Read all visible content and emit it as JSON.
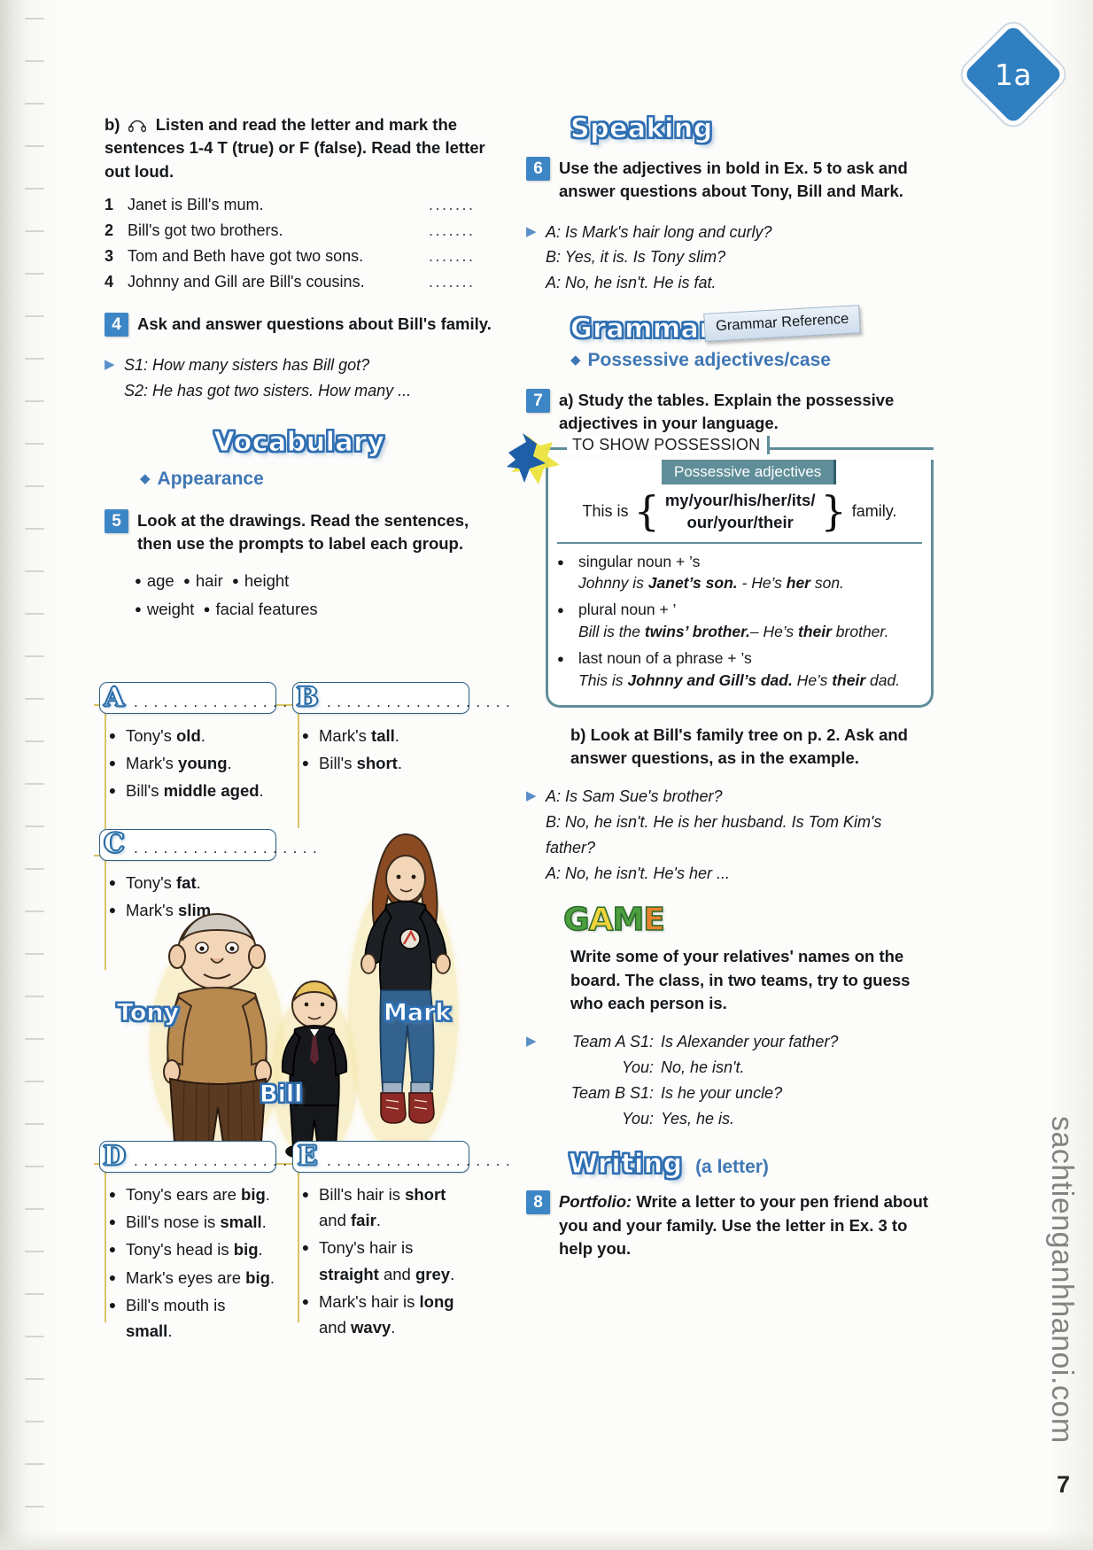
{
  "unit_badge": "1a",
  "page_number": "7",
  "watermark": "sachtienganhhanoi.com",
  "left": {
    "ex3b": {
      "lead": "b)",
      "headphone_icon": "headphones-icon",
      "instruction": "Listen and read the letter and mark the sentences 1-4 T (true) or F (false). Read the letter out loud.",
      "sentences": [
        {
          "n": "1",
          "text": "Janet is Bill's mum.",
          "dots": "......."
        },
        {
          "n": "2",
          "text": "Bill's got two brothers.",
          "dots": "......."
        },
        {
          "n": "3",
          "text": "Tom and Beth have got two sons.",
          "dots": "......."
        },
        {
          "n": "4",
          "text": "Johnny and Gill are Bill's cousins.",
          "dots": "......."
        }
      ]
    },
    "ex4": {
      "number": "4",
      "instruction": "Ask and answer questions about Bill's family.",
      "dialogue": [
        "S1: How many sisters has Bill got?",
        "S2: He has got two sisters. How many ..."
      ]
    },
    "vocabulary_heading": "Vocabulary",
    "vocabulary_sub": "Appearance",
    "ex5": {
      "number": "5",
      "instruction": "Look at the drawings. Read the sentences, then use the prompts to label each group.",
      "prompts_line1": [
        "age",
        "hair",
        "height"
      ],
      "prompts_line2": [
        "weight",
        "facial features"
      ],
      "groups": [
        {
          "letter": "A",
          "dots": "...................",
          "items": [
            {
              "pre": "Tony's ",
              "bold": "old",
              "post": "."
            },
            {
              "pre": "Mark's ",
              "bold": "young",
              "post": "."
            },
            {
              "pre": "Bill's ",
              "bold": "middle aged",
              "post": "."
            }
          ]
        },
        {
          "letter": "B",
          "dots": "...................",
          "items": [
            {
              "pre": "Mark's ",
              "bold": "tall",
              "post": "."
            },
            {
              "pre": "Bill's ",
              "bold": "short",
              "post": "."
            }
          ]
        },
        {
          "letter": "C",
          "dots": "...................",
          "items": [
            {
              "pre": "Tony's ",
              "bold": "fat",
              "post": "."
            },
            {
              "pre": "Mark's ",
              "bold": "slim",
              "post": "."
            }
          ]
        },
        {
          "letter": "D",
          "dots": "...................",
          "items": [
            {
              "pre": "Tony's ears are ",
              "bold": "big",
              "post": "."
            },
            {
              "pre": "Bill's nose is ",
              "bold": "small",
              "post": "."
            },
            {
              "pre": "Tony's head is ",
              "bold": "big",
              "post": "."
            },
            {
              "pre": "Mark's eyes are ",
              "bold": "big",
              "post": "."
            },
            {
              "pre": "Bill's mouth is ",
              "bold": "small",
              "post": "."
            }
          ]
        },
        {
          "letter": "E",
          "dots": "...................",
          "items": [
            {
              "pre": "Bill's hair is ",
              "bold": "short",
              "post": " and ",
              "bold2": "fair",
              "post2": "."
            },
            {
              "pre": "Tony's hair is ",
              "bold": "straight",
              "post": " and ",
              "bold2": "grey",
              "post2": "."
            },
            {
              "pre": "Mark's hair is ",
              "bold": "long",
              "post": " and ",
              "bold2": "wavy",
              "post2": "."
            }
          ]
        }
      ],
      "figure_labels": {
        "tony": "Tony",
        "bill": "Bill",
        "mark": "Mark"
      }
    }
  },
  "right": {
    "speaking_heading": "Speaking",
    "ex6": {
      "number": "6",
      "instruction": "Use the adjectives in bold in Ex. 5 to ask and answer questions about Tony, Bill and Mark.",
      "dialogue": [
        "A: Is Mark's hair long and curly?",
        "B: Yes, it is. Is Tony slim?",
        "A: No, he isn't. He is fat."
      ]
    },
    "grammar_heading": "Grammar",
    "grammar_reference_tag": "Grammar Reference",
    "grammar_sub": "Possessive adjectives/case",
    "ex7": {
      "number": "7",
      "instruction_a": "a) Study the tables. Explain the possessive adjectives in your language.",
      "table": {
        "title": "TO SHOW POSSESSION",
        "subtitle": "Possessive adjectives",
        "lead": "This is",
        "values_line1": "my/your/his/her/its/",
        "values_line2": "our/your/their",
        "tail": "family.",
        "rules": [
          {
            "rule": "singular noun + ’s",
            "example_parts": [
              "Johnny is ",
              "Janet’s son.",
              " - He’s ",
              "her",
              " son."
            ]
          },
          {
            "rule": "plural noun + ’",
            "example_parts": [
              "Bill is the ",
              "twins’ brother.",
              "– He’s ",
              "their",
              " brother."
            ]
          },
          {
            "rule": "last noun of a phrase + ’s",
            "example_parts": [
              "This is ",
              "Johnny and Gill’s dad.",
              " He’s ",
              "their",
              " dad."
            ]
          }
        ]
      },
      "instruction_b": "b) Look at Bill's family tree on p. 2. Ask and answer questions, as in the example.",
      "dialogue_b": [
        "A: Is Sam Sue's brother?",
        "B: No, he isn't. He is her husband. Is Tom Kim's father?",
        "A: No, he isn't. He's her ..."
      ]
    },
    "game": {
      "logo": "GAME",
      "logo_letters": [
        {
          "ch": "G",
          "color": "#4c9e3f"
        },
        {
          "ch": "A",
          "color": "#f2d33c"
        },
        {
          "ch": "M",
          "color": "#4c9e3f"
        },
        {
          "ch": "E",
          "color": "#e8822c"
        }
      ],
      "instruction": "Write some of your relatives' names on the board. The class, in two teams, try to guess who each person is.",
      "dialogue": [
        {
          "spk": "Team A S1:",
          "txt": "Is Alexander your father?"
        },
        {
          "spk": "You:",
          "txt": "No, he isn't."
        },
        {
          "spk": "Team B S1:",
          "txt": "Is he your uncle?"
        },
        {
          "spk": "You:",
          "txt": "Yes, he is."
        }
      ]
    },
    "writing_heading": "Writing",
    "writing_sub": "(a letter)",
    "ex8": {
      "number": "8",
      "label": "Portfolio:",
      "instruction": "Write a letter to your pen friend about you and your family. Use the letter in Ex. 3 to help you."
    }
  },
  "colors": {
    "accent_blue": "#3d86c6",
    "heading_outline": "#2f6fb2",
    "grammar_teal": "#5f8e99",
    "rule_yellow": "#d9c463"
  }
}
